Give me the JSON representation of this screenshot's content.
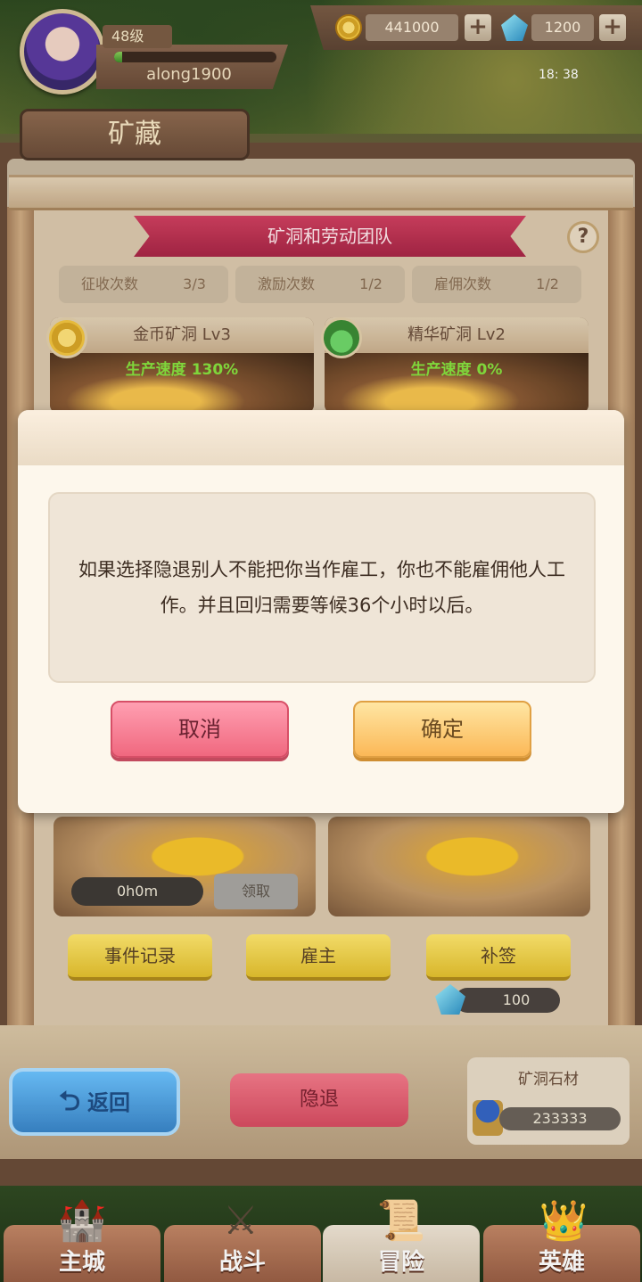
{
  "player": {
    "level": "48级",
    "name": "along1900",
    "xp_fraction": 0.05
  },
  "resources": {
    "gold": "441000",
    "gems": "1200",
    "plus": "+"
  },
  "status": {
    "time": "18: 38"
  },
  "screen": {
    "title": "矿藏"
  },
  "section": {
    "banner": "矿洞和劳动团队",
    "help": "?"
  },
  "counters": [
    {
      "label": "征收次数",
      "value": "3/3"
    },
    {
      "label": "激励次数",
      "value": "1/2"
    },
    {
      "label": "雇佣次数",
      "value": "1/2"
    }
  ],
  "mines": [
    {
      "name": "金币矿洞 Lv3",
      "rate": "生产速度 130%"
    },
    {
      "name": "精华矿洞 Lv2",
      "rate": "生产速度 0%"
    }
  ],
  "mine_actions": {
    "timer": "0h0m",
    "collect": "领取"
  },
  "actions": {
    "log": "事件记录",
    "employer": "雇主",
    "sign": "补签",
    "sign_cost": "100"
  },
  "bottom": {
    "back": "返回",
    "back_arrow": "⮌",
    "retire": "隐退",
    "stone_title": "矿洞石材",
    "stone_value": "233333"
  },
  "nav": [
    {
      "label": "主城",
      "icon": "🏰"
    },
    {
      "label": "战斗",
      "icon": "⚔"
    },
    {
      "label": "冒险",
      "icon": "📜"
    },
    {
      "label": "英雄",
      "icon": "👑"
    }
  ],
  "dialog": {
    "message": "如果选择隐退别人不能把你当作雇工，你也不能雇佣他人工作。并且回归需要等候36个小时以后。",
    "cancel": "取消",
    "confirm": "确定"
  }
}
